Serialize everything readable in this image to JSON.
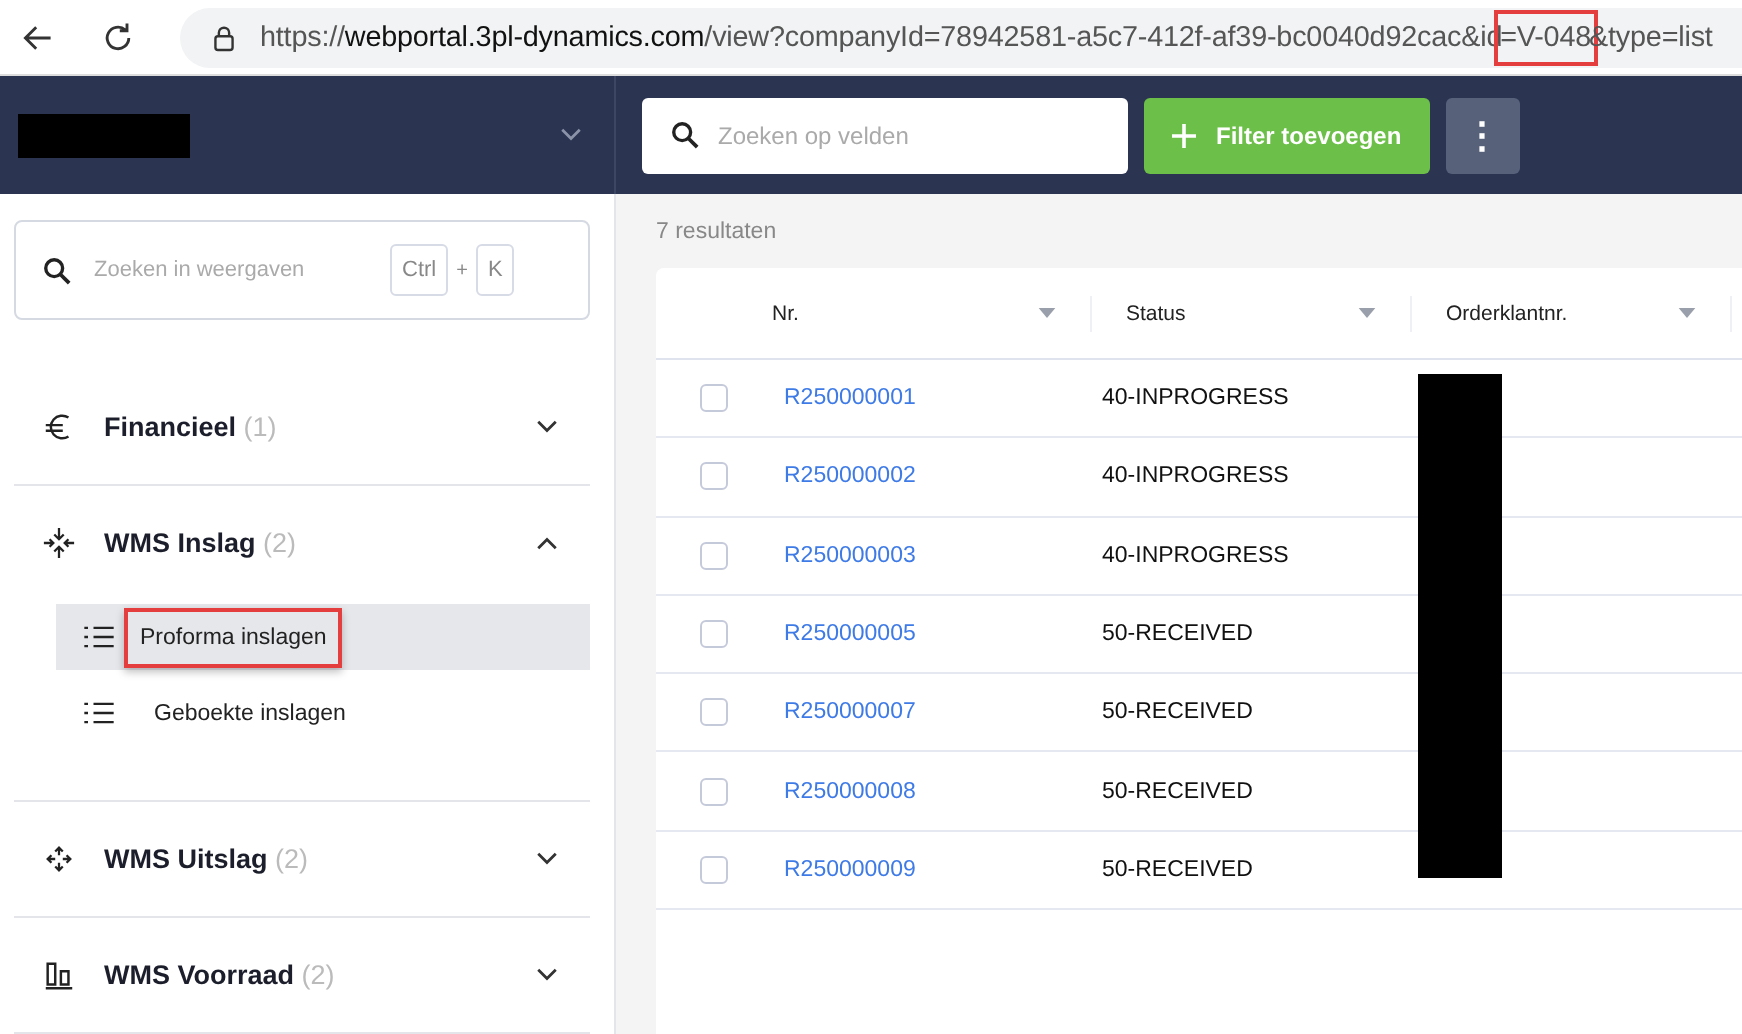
{
  "browser": {
    "url_segments": [
      {
        "text": "https://",
        "kind": "dim"
      },
      {
        "text": "webportal.3pl-dynamics.com",
        "kind": "domain"
      },
      {
        "text": "/view?companyId=78942581-a5c7-412f-af39-bc0040d92cac&id",
        "kind": "dim"
      },
      {
        "text": "=V-048",
        "kind": "highlighted"
      },
      {
        "text": "&type=list",
        "kind": "dim"
      }
    ]
  },
  "header": {
    "search": {
      "placeholder": "Zoeken op velden"
    },
    "filter_button": "Filter toevoegen",
    "more_button": "⋮"
  },
  "sidebar": {
    "search": {
      "placeholder": "Zoeken in weergaven",
      "shortcut_keys": [
        "Ctrl",
        "K"
      ],
      "shortcut_joiner": "+"
    },
    "groups": [
      {
        "label": "Financieel",
        "count": "(1)",
        "expanded": false
      },
      {
        "label": "WMS Inslag",
        "count": "(2)",
        "expanded": true,
        "children": [
          {
            "label": "Proforma inslagen",
            "selected": true
          },
          {
            "label": "Geboekte inslagen",
            "selected": false
          }
        ]
      },
      {
        "label": "WMS Uitslag",
        "count": "(2)",
        "expanded": false
      },
      {
        "label": "WMS Voorraad",
        "count": "(2)",
        "expanded": false
      }
    ]
  },
  "results_count": "7 resultaten",
  "table": {
    "columns": [
      "Nr.",
      "Status",
      "Orderklantnr."
    ],
    "rows": [
      {
        "nr": "R250000001",
        "status": "40-INPROGRESS",
        "checked": false
      },
      {
        "nr": "R250000002",
        "status": "40-INPROGRESS",
        "checked": false
      },
      {
        "nr": "R250000003",
        "status": "40-INPROGRESS",
        "checked": false
      },
      {
        "nr": "R250000005",
        "status": "50-RECEIVED",
        "checked": false
      },
      {
        "nr": "R250000007",
        "status": "50-RECEIVED",
        "checked": false
      },
      {
        "nr": "R250000008",
        "status": "50-RECEIVED",
        "checked": false
      },
      {
        "nr": "R250000009",
        "status": "50-RECEIVED",
        "checked": false
      }
    ]
  }
}
